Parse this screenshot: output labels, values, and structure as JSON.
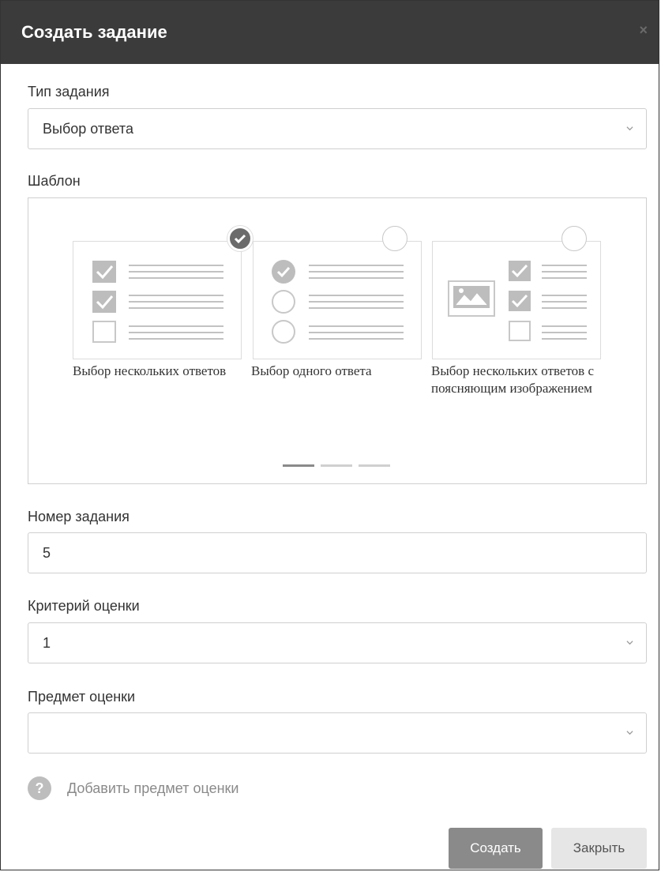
{
  "dialog": {
    "title": "Создать задание",
    "close_glyph": "×"
  },
  "task_type": {
    "label": "Тип задания",
    "value": "Выбор ответа"
  },
  "template": {
    "label": "Шаблон",
    "cards": [
      {
        "label": "Выбор нескольких ответов",
        "selected": true,
        "icon": "multiple-choice-checkbox-icon"
      },
      {
        "label": "Выбор одного ответа",
        "selected": false,
        "icon": "single-choice-radio-icon"
      },
      {
        "label": "Выбор нескольких ответов с поясняющим изображением",
        "selected": false,
        "icon": "multiple-choice-image-icon"
      }
    ],
    "pager_pages": 3,
    "pager_active": 1
  },
  "task_number": {
    "label": "Номер задания",
    "value": "5"
  },
  "criterion": {
    "label": "Критерий оценки",
    "value": "1"
  },
  "subject": {
    "label": "Предмет оценки",
    "value": ""
  },
  "add_subject": {
    "icon_glyph": "?",
    "label": "Добавить предмет оценки"
  },
  "buttons": {
    "create": "Создать",
    "close": "Закрыть"
  },
  "colors": {
    "header_bg": "#3b3b3b",
    "primary_button": "#8a8a8a",
    "secondary_button": "#e6e6e6"
  }
}
